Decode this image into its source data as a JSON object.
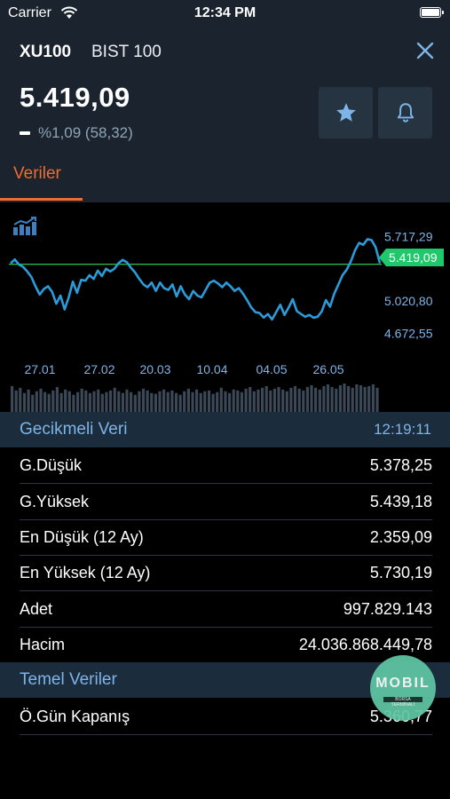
{
  "status_bar": {
    "carrier": "Carrier",
    "time": "12:34 PM"
  },
  "header": {
    "symbol": "XU100",
    "name": "BIST 100",
    "price": "5.419,09",
    "change": "%1,09 (58,32)",
    "tab": "Veriler"
  },
  "chart_data": {
    "type": "line",
    "x": [
      "27.01",
      "27.02",
      "20.03",
      "10.04",
      "04.05",
      "26.05"
    ],
    "y_ticks": [
      "5.717,29",
      "5.020,80",
      "4.672,55"
    ],
    "current_value_label": "5.419,09",
    "current_value": 5419.09,
    "ylim": [
      4550,
      5800
    ],
    "series": [
      {
        "values": [
          5430,
          5470,
          5415,
          5390,
          5340,
          5280,
          5180,
          5090,
          5150,
          5180,
          5120,
          4990,
          5080,
          4930,
          5060,
          5230,
          5110,
          5250,
          5240,
          5300,
          5260,
          5350,
          5290,
          5370,
          5340,
          5370,
          5430,
          5465,
          5440,
          5380,
          5330,
          5260,
          5200,
          5170,
          5220,
          5130,
          5220,
          5160,
          5140,
          5200,
          5070,
          5180,
          5090,
          5040,
          5130,
          5080,
          5060,
          5140,
          5220,
          5240,
          5210,
          5170,
          5220,
          5180,
          5130,
          5160,
          5100,
          5030,
          4950,
          4900,
          4890,
          4840,
          4880,
          4820,
          4900,
          4980,
          4870,
          4950,
          5040,
          4910,
          4880,
          4850,
          4870,
          4840,
          4850,
          4910,
          5030,
          4960,
          5100,
          5200,
          5300,
          5360,
          5450,
          5570,
          5650,
          5630,
          5690,
          5680,
          5600,
          5430
        ]
      }
    ],
    "volume": [
      30,
      25,
      28,
      22,
      26,
      20,
      24,
      27,
      23,
      21,
      25,
      29,
      22,
      26,
      24,
      20,
      23,
      27,
      25,
      22,
      24,
      26,
      21,
      23,
      25,
      28,
      24,
      22,
      26,
      23,
      20,
      24,
      27,
      25,
      22,
      21,
      24,
      26,
      23,
      25,
      22,
      20,
      24,
      27,
      23,
      26,
      22,
      24,
      25,
      21,
      23,
      28,
      24,
      22,
      26,
      25,
      23,
      27,
      29,
      24,
      26,
      28,
      30,
      25,
      27,
      29,
      26,
      24,
      28,
      30,
      27,
      25,
      29,
      31,
      28,
      26,
      30,
      32,
      29,
      27,
      31,
      33,
      30,
      28,
      32,
      31,
      29,
      30,
      32,
      28
    ]
  },
  "delayed": {
    "title": "Gecikmeli Veri",
    "time": "12:19:11",
    "rows": [
      {
        "label": "G.Düşük",
        "value": "5.378,25"
      },
      {
        "label": "G.Yüksek",
        "value": "5.439,18"
      },
      {
        "label": "En Düşük (12 Ay)",
        "value": "2.359,09"
      },
      {
        "label": "En Yüksek (12 Ay)",
        "value": "5.730,19"
      },
      {
        "label": "Adet",
        "value": "997.829.143"
      },
      {
        "label": "Hacim",
        "value": "24.036.868.449,78"
      }
    ]
  },
  "fundamentals": {
    "title": "Temel Veriler",
    "rows": [
      {
        "label": "Ö.Gün Kapanış",
        "value": "5.360,77"
      }
    ]
  },
  "watermark": {
    "text": "MOBIL",
    "sub": "BORSA TERMİNALİ"
  },
  "colors": {
    "accent_orange": "#f26b2f",
    "section_blue": "#7fb4e8",
    "price_line": "#2b9bd9",
    "reference_line": "#2ec24d",
    "header_bg": "#1b242e"
  },
  "icons": {
    "close": "close-icon",
    "star": "star-icon",
    "bell": "bell-icon",
    "chart": "chart-type-icon",
    "wifi": "wifi-icon",
    "battery": "battery-icon"
  }
}
